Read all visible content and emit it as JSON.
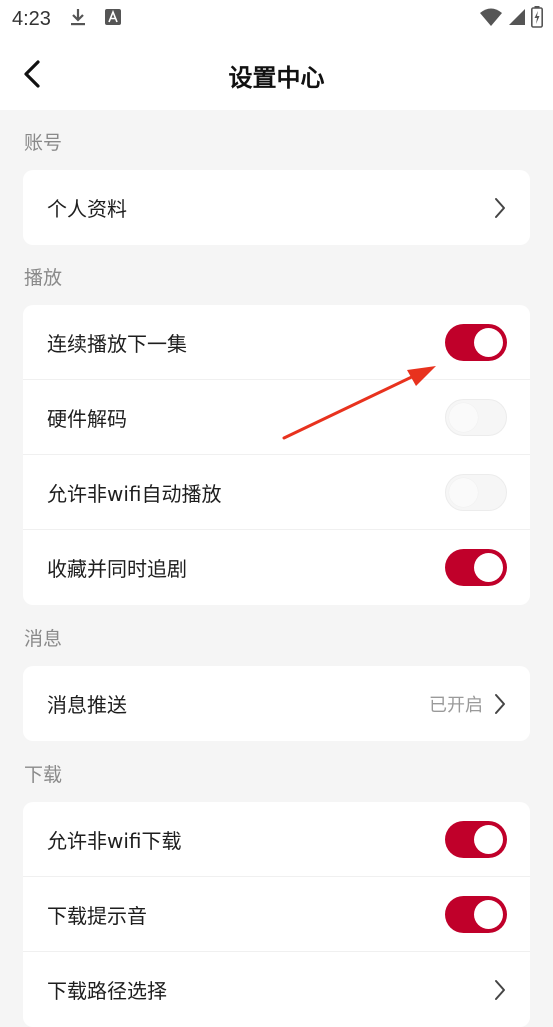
{
  "status_bar": {
    "time": "4:23",
    "icons": [
      "download-icon",
      "text-a-icon",
      "wifi-icon",
      "signal-icon",
      "battery-icon"
    ]
  },
  "header": {
    "title": "设置中心",
    "back_icon": "chevron-left-icon"
  },
  "sections": {
    "account": {
      "label": "账号",
      "items": [
        {
          "label": "个人资料",
          "type": "link"
        }
      ]
    },
    "playback": {
      "label": "播放",
      "items": [
        {
          "label": "连续播放下一集",
          "type": "toggle",
          "on": true
        },
        {
          "label": "硬件解码",
          "type": "toggle",
          "on": false
        },
        {
          "label": "允许非wifi自动播放",
          "type": "toggle",
          "on": false
        },
        {
          "label": "收藏并同时追剧",
          "type": "toggle",
          "on": true
        }
      ]
    },
    "message": {
      "label": "消息",
      "items": [
        {
          "label": "消息推送",
          "type": "link",
          "value": "已开启"
        }
      ]
    },
    "download": {
      "label": "下载",
      "items": [
        {
          "label": "允许非wifi下载",
          "type": "toggle",
          "on": true
        },
        {
          "label": "下载提示音",
          "type": "toggle",
          "on": true
        },
        {
          "label": "下载路径选择",
          "type": "link"
        }
      ]
    }
  },
  "colors": {
    "accent": "#c0002a",
    "annotation_arrow": "#e8321e",
    "background": "#f5f5f5"
  }
}
